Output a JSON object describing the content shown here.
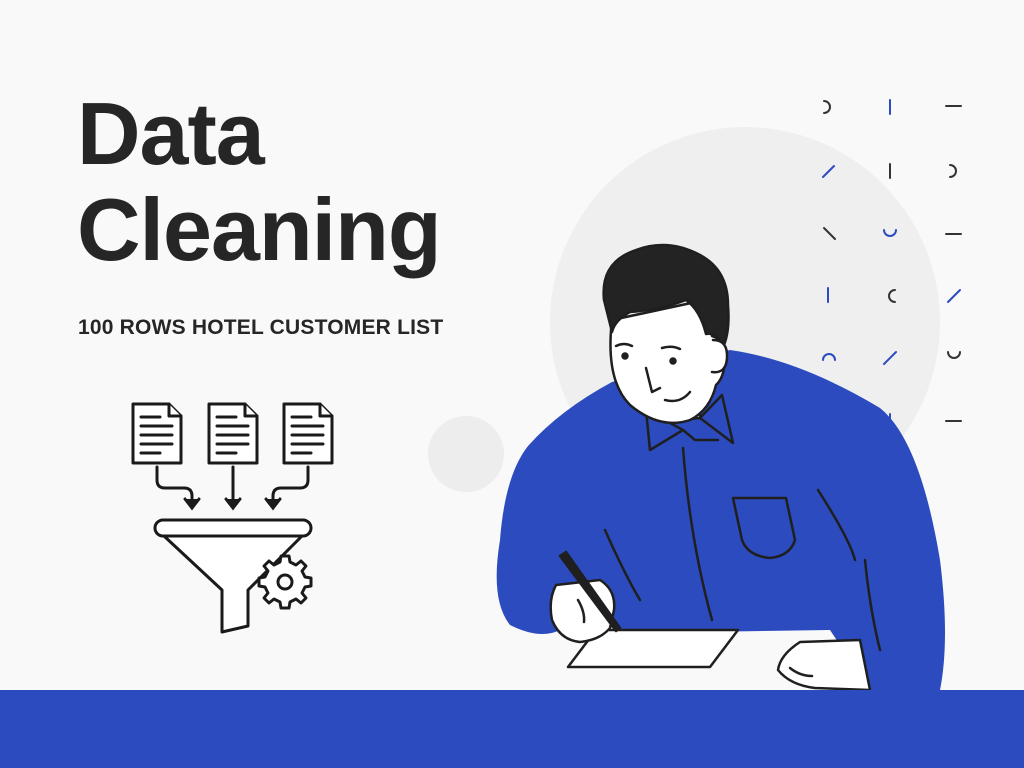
{
  "hero": {
    "title_line1": "Data",
    "title_line2": "Cleaning",
    "subtitle": "100 ROWS HOTEL CUSTOMER LIST"
  },
  "colors": {
    "background": "#f9f9f9",
    "accent_blue": "#2b4bbf",
    "ink": "#1f1f1f",
    "circle_gray": "#efefef"
  },
  "icons": {
    "illustration": "man-writing-illustration",
    "funnel": "data-funnel-icon",
    "gear": "gear-icon",
    "documents": "document-icon"
  }
}
